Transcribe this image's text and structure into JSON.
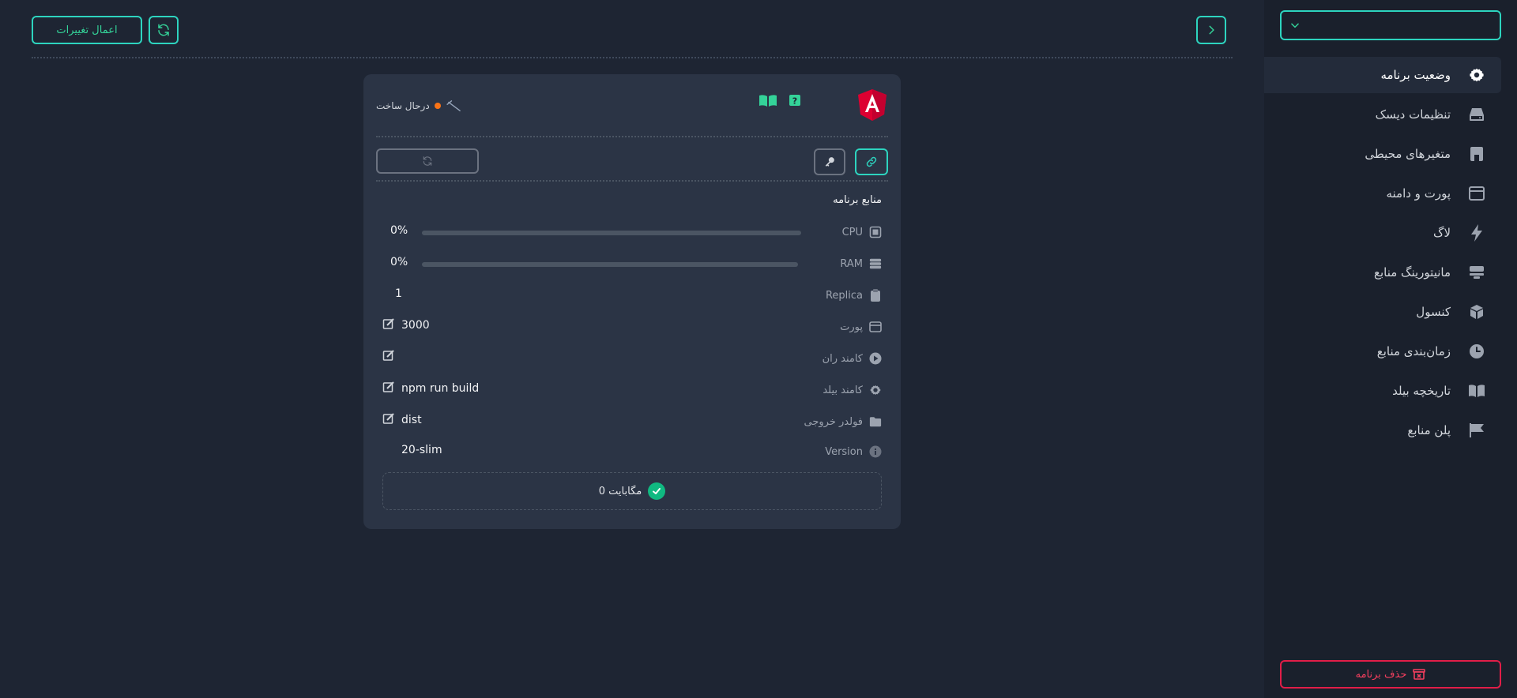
{
  "toolbar": {
    "apply_label": "اعمال تغییرات",
    "refresh_icon": "refresh-icon",
    "back_icon": "chevron-left-icon"
  },
  "card": {
    "status_text": "درحال ساخت",
    "status_color": "#f97316",
    "section_title": "منابع برنامه",
    "resources": {
      "cpu": {
        "label": "CPU",
        "value": "0%",
        "percent": 0
      },
      "ram": {
        "label": "RAM",
        "value": "0%",
        "percent": 0
      }
    },
    "fields": {
      "replica": {
        "label": "Replica",
        "value": "1"
      },
      "port": {
        "label": "پورت",
        "value": "3000"
      },
      "run_command": {
        "label": "کامند ران",
        "value": ""
      },
      "build_command": {
        "label": "کامند بیلد",
        "value": "npm run build"
      },
      "output_folder": {
        "label": "فولدر خروجی",
        "value": "dist"
      },
      "version": {
        "label": "Version",
        "value": "20-slim"
      }
    },
    "storage": {
      "text": "مگابایت 0"
    }
  },
  "sidebar": {
    "select_value": "",
    "items": [
      {
        "label": "وضعیت برنامه",
        "icon": "gear-icon"
      },
      {
        "label": "تنظیمات دیسک",
        "icon": "disk-icon"
      },
      {
        "label": "متغیرهای محیطی",
        "icon": "variables-icon"
      },
      {
        "label": "پورت و دامنه",
        "icon": "window-icon"
      },
      {
        "label": "لاگ",
        "icon": "bolt-icon"
      },
      {
        "label": "مانیتورینگ منابع",
        "icon": "server-icon"
      },
      {
        "label": "کنسول",
        "icon": "cube-icon"
      },
      {
        "label": "زمان‌بندی منابع",
        "icon": "clock-icon"
      },
      {
        "label": "تاریخچه بیلد",
        "icon": "book-icon"
      },
      {
        "label": "پلن منابع",
        "icon": "flag-icon"
      }
    ],
    "delete_label": "حذف برنامه"
  },
  "colors": {
    "accent": "#2dd4bf",
    "accent_text": "#34d399",
    "danger": "#e11d48",
    "success": "#10b981"
  }
}
